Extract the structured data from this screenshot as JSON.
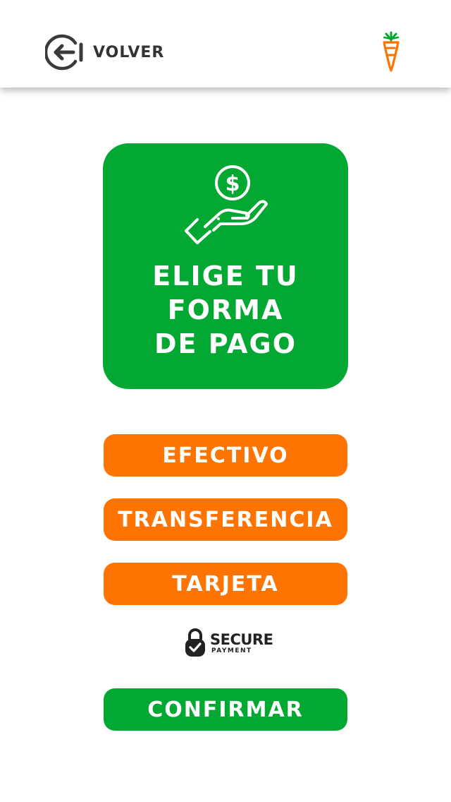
{
  "header": {
    "back_label": "VOLVER",
    "back_icon": "back-arrow-icon",
    "logo_icon": "carrot-logo-icon"
  },
  "hero": {
    "icon": "hand-holding-dollar-icon",
    "title_lines": [
      "ELIGE TU",
      "FORMA",
      "DE PAGO"
    ]
  },
  "payment_options": [
    "EFECTIVO",
    "TRANSFERENCIA",
    "TARJETA"
  ],
  "secure_badge": {
    "title": "SECURE",
    "subtitle": "PAYMENT",
    "icon": "lock-check-icon"
  },
  "confirm_label": "CONFIRMAR",
  "colors": {
    "green": "#02a831",
    "orange": "#ff7300",
    "header_text": "#333333"
  }
}
